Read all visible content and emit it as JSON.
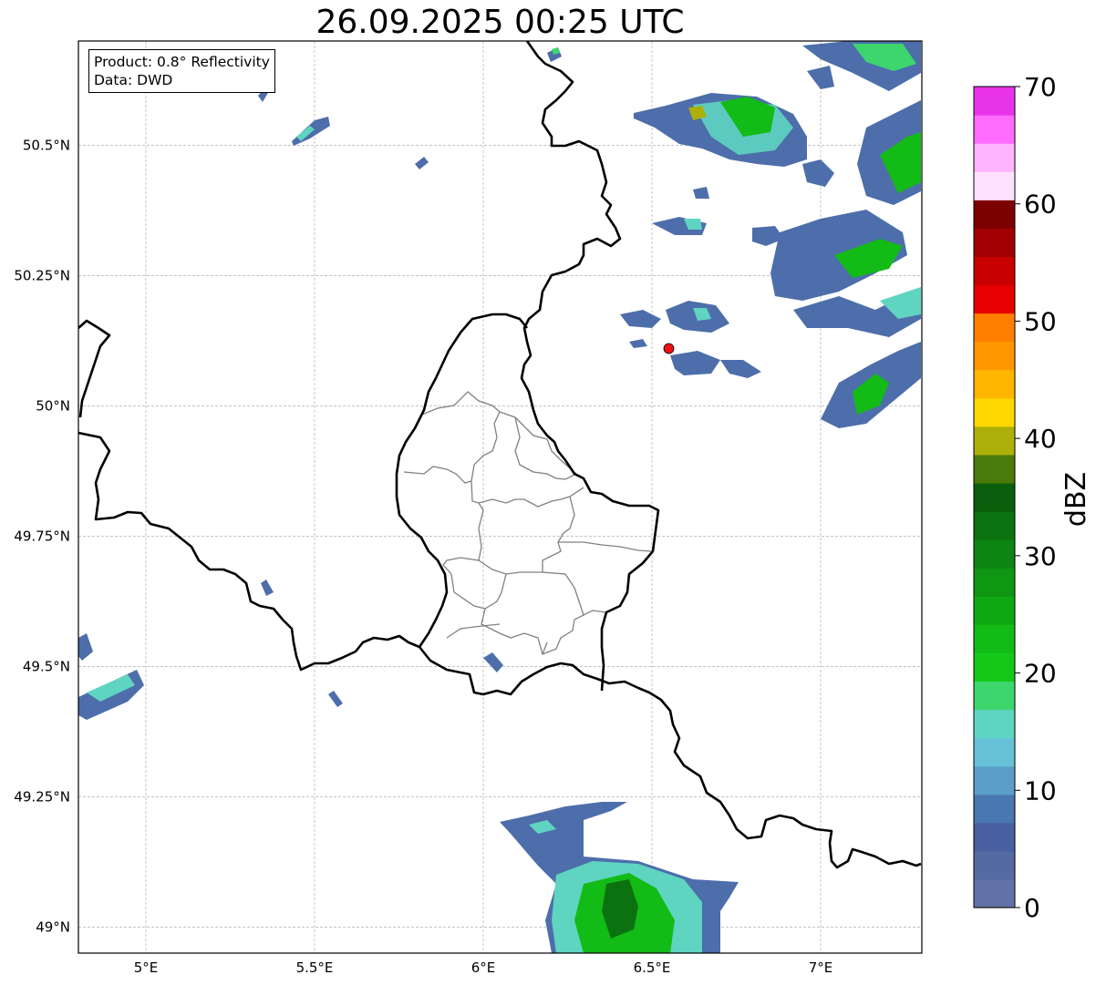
{
  "title": "26.09.2025 00:25 UTC",
  "info": {
    "product": "Product: 0.8° Reflectivity",
    "data": "Data: DWD"
  },
  "map": {
    "lon_range": [
      4.8,
      7.3
    ],
    "lat_range": [
      48.95,
      50.7
    ],
    "x_ticks": [
      {
        "value": 5.0,
        "label": "5°E"
      },
      {
        "value": 5.5,
        "label": "5.5°E"
      },
      {
        "value": 6.0,
        "label": "6°E"
      },
      {
        "value": 6.5,
        "label": "6.5°E"
      },
      {
        "value": 7.0,
        "label": "7°E"
      }
    ],
    "y_ticks": [
      {
        "value": 50.5,
        "label": "50.5°N"
      },
      {
        "value": 50.25,
        "label": "50.25°N"
      },
      {
        "value": 50.0,
        "label": "50°N"
      },
      {
        "value": 49.75,
        "label": "49.75°N"
      },
      {
        "value": 49.5,
        "label": "49.5°N"
      },
      {
        "value": 49.25,
        "label": "49.25°N"
      },
      {
        "value": 49.0,
        "label": "49°N"
      }
    ],
    "grid": true,
    "marker": {
      "lon": 6.55,
      "lat": 50.11,
      "color": "#ee1111"
    }
  },
  "colorbar": {
    "label": "dBZ",
    "vmin": 0,
    "vmax": 70,
    "ticks": [
      0,
      10,
      20,
      30,
      40,
      50,
      60,
      70
    ],
    "colors": [
      "#6272a6",
      "#566aa2",
      "#4860a2",
      "#4877b1",
      "#5b9dc8",
      "#66c0d8",
      "#5fd4c1",
      "#3dd66d",
      "#14c81a",
      "#12bb15",
      "#10a812",
      "#0f9612",
      "#0e8412",
      "#0c7210",
      "#0a5e0c",
      "#4a7a0a",
      "#adb00a",
      "#ffd700",
      "#ffb600",
      "#ff9800",
      "#ff7f00",
      "#e60000",
      "#c80000",
      "#a00000",
      "#7c0000",
      "#ffe1ff",
      "#ffb4ff",
      "#ff6cff",
      "#e833e8"
    ]
  }
}
